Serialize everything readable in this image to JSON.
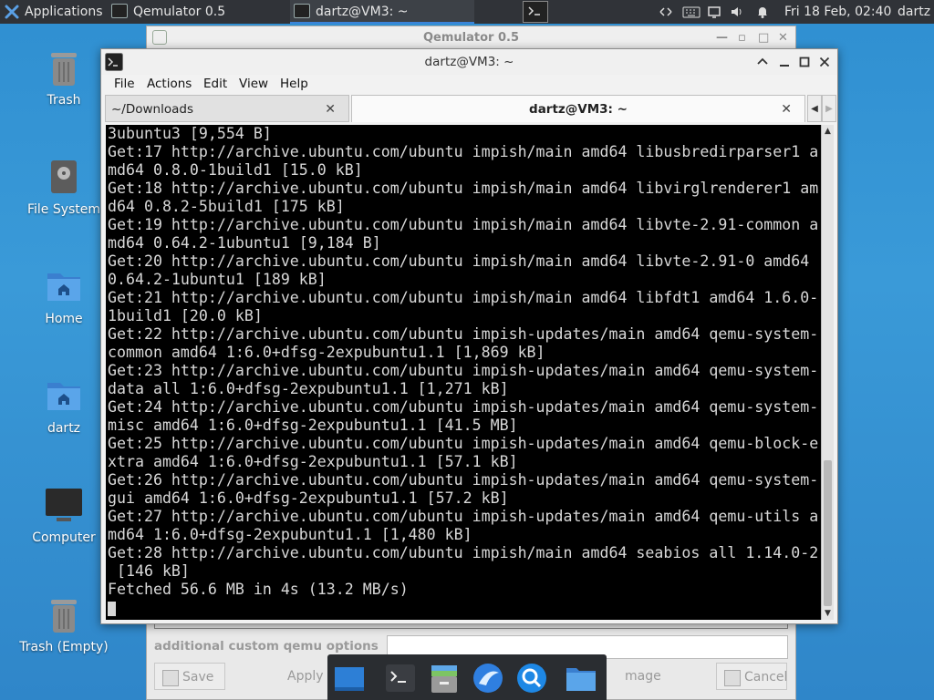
{
  "top_panel": {
    "applications_label": "Applications",
    "tasks": [
      {
        "label": "Qemulator 0.5"
      },
      {
        "label": "dartz@VM3: ~"
      }
    ],
    "clock": "Fri 18 Feb, 02:40",
    "user": "dartz",
    "tray_icons": [
      "network-icon",
      "keyboard-icon",
      "display-icon",
      "volume-icon",
      "notification-bell-icon"
    ]
  },
  "desktop": {
    "icons": [
      {
        "label": "Trash"
      },
      {
        "label": "File System"
      },
      {
        "label": "Home"
      },
      {
        "label": "dartz"
      },
      {
        "label": "Computer"
      },
      {
        "label": "Trash (Empty)"
      }
    ]
  },
  "qemulator": {
    "title": "Qemulator 0.5",
    "custom_options_label": "additional custom qemu options",
    "buttons": {
      "save": "Save",
      "apply": "Apply",
      "image": "mage",
      "cancel": "Cancel"
    }
  },
  "terminal": {
    "title": "dartz@VM3: ~",
    "menu": [
      "File",
      "Actions",
      "Edit",
      "View",
      "Help"
    ],
    "tabs": [
      {
        "label": "~/Downloads"
      },
      {
        "label": "dartz@VM3: ~"
      }
    ],
    "lines": [
      "3ubuntu3 [9,554 B]",
      "Get:17 http://archive.ubuntu.com/ubuntu impish/main amd64 libusbredirparser1 a",
      "md64 0.8.0-1build1 [15.0 kB]",
      "Get:18 http://archive.ubuntu.com/ubuntu impish/main amd64 libvirglrenderer1 am",
      "d64 0.8.2-5build1 [175 kB]",
      "Get:19 http://archive.ubuntu.com/ubuntu impish/main amd64 libvte-2.91-common a",
      "md64 0.64.2-1ubuntu1 [9,184 B]",
      "Get:20 http://archive.ubuntu.com/ubuntu impish/main amd64 libvte-2.91-0 amd64",
      "0.64.2-1ubuntu1 [189 kB]",
      "Get:21 http://archive.ubuntu.com/ubuntu impish/main amd64 libfdt1 amd64 1.6.0-",
      "1build1 [20.0 kB]",
      "Get:22 http://archive.ubuntu.com/ubuntu impish-updates/main amd64 qemu-system-",
      "common amd64 1:6.0+dfsg-2expubuntu1.1 [1,869 kB]",
      "Get:23 http://archive.ubuntu.com/ubuntu impish-updates/main amd64 qemu-system-",
      "data all 1:6.0+dfsg-2expubuntu1.1 [1,271 kB]",
      "Get:24 http://archive.ubuntu.com/ubuntu impish-updates/main amd64 qemu-system-",
      "misc amd64 1:6.0+dfsg-2expubuntu1.1 [41.5 MB]",
      "Get:25 http://archive.ubuntu.com/ubuntu impish-updates/main amd64 qemu-block-e",
      "xtra amd64 1:6.0+dfsg-2expubuntu1.1 [57.1 kB]",
      "Get:26 http://archive.ubuntu.com/ubuntu impish-updates/main amd64 qemu-system-",
      "gui amd64 1:6.0+dfsg-2expubuntu1.1 [57.2 kB]",
      "Get:27 http://archive.ubuntu.com/ubuntu impish-updates/main amd64 qemu-utils a",
      "md64 1:6.0+dfsg-2expubuntu1.1 [1,480 kB]",
      "Get:28 http://archive.ubuntu.com/ubuntu impish/main amd64 seabios all 1.14.0-2",
      " [146 kB]",
      "Fetched 56.6 MB in 4s (13.2 MB/s)"
    ]
  },
  "dock": {
    "items": [
      "show-desktop-icon",
      "terminal-icon",
      "file-manager-icon",
      "web-browser-icon",
      "app-finder-icon",
      "folder-icon"
    ]
  },
  "colors": {
    "panel": "#303338",
    "desktop": "#2f8fd1",
    "terminal_bg": "#000000",
    "terminal_fg": "#d8d8d8",
    "accent": "#3b83d8"
  }
}
